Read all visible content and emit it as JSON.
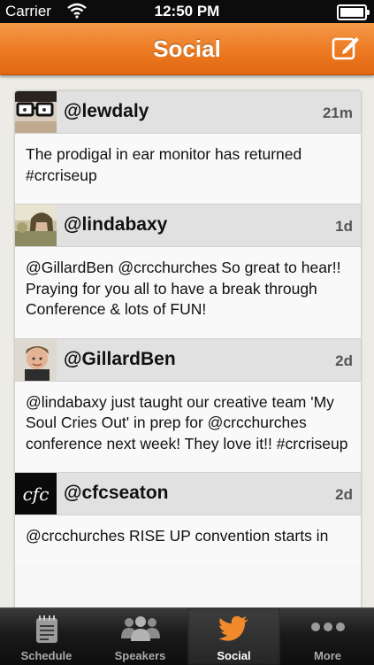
{
  "status_bar": {
    "carrier": "Carrier",
    "time": "12:50 PM"
  },
  "nav": {
    "title": "Social",
    "compose_icon": "compose-icon"
  },
  "tweets": [
    {
      "handle": "@lewdaly",
      "age": "21m",
      "text": "The prodigal in ear monitor has returned #crcriseup"
    },
    {
      "handle": "@lindabaxy",
      "age": "1d",
      "text": "@GillardBen @crcchurches So great to hear!! Praying for you all to have a break through Conference & lots of FUN!"
    },
    {
      "handle": "@GillardBen",
      "age": "2d",
      "text": "@lindabaxy just taught our creative team 'My Soul Cries Out' in prep for @crcchurches conference next week! They love it!! #crcriseup"
    },
    {
      "handle": "@cfcseaton",
      "age": "2d",
      "avatar_text": "cfc",
      "text": "@crcchurches RISE UP convention starts in"
    }
  ],
  "tabs": [
    {
      "label": "Schedule",
      "icon": "schedule-icon"
    },
    {
      "label": "Speakers",
      "icon": "speakers-icon"
    },
    {
      "label": "Social",
      "icon": "twitter-bird-icon"
    },
    {
      "label": "More",
      "icon": "more-dots-icon"
    }
  ],
  "colors": {
    "nav_orange": "#ec7a21",
    "tab_active_icon": "#f08a2c"
  }
}
